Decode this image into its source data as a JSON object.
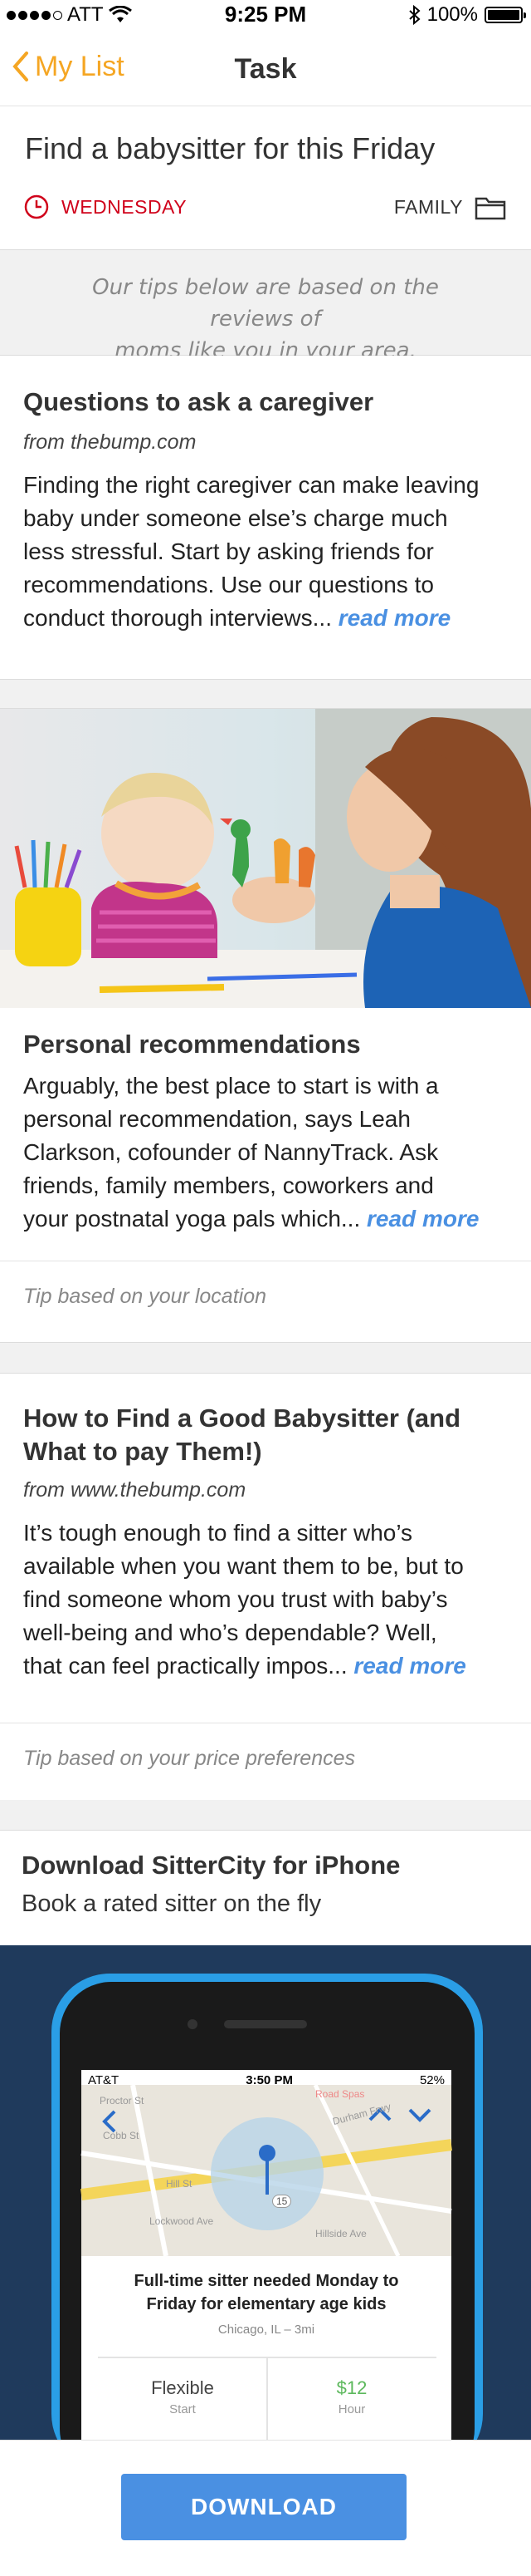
{
  "status_bar": {
    "carrier": "ATT",
    "time": "9:25 PM",
    "battery": "100%"
  },
  "nav": {
    "back_label": "My List",
    "title": "Task"
  },
  "task": {
    "title": "Find a babysitter for this Friday",
    "day": "WEDNESDAY",
    "category": "FAMILY"
  },
  "info_banner": {
    "text_line1": "Our tips below are based on the reviews of",
    "text_line2": "moms like you in your area."
  },
  "cards": [
    {
      "title": "Questions to ask a caregiver",
      "source": "from thebump.com",
      "body_lines": [
        "Finding the right caregiver can make leaving",
        "baby under someone else’s charge much",
        "less stressful. Start by asking friends for",
        "recommendations. Use our questions to"
      ],
      "last_line": "conduct thorough interviews...",
      "read_more": "read more"
    },
    {
      "title": "Personal recommendations",
      "body_lines": [
        "Arguably, the best place to start is with a",
        "personal recommendation, says Leah",
        "Clarkson, cofounder of NannyTrack. Ask",
        "friends, family members, coworkers and"
      ],
      "last_line": "your postnatal yoga pals which...",
      "read_more": "read more",
      "footer": "Tip based on your location"
    },
    {
      "title_line1": "How to Find a Good Babysitter (and",
      "title_line2": "What to pay Them!)",
      "source": "from www.thebump.com",
      "body_lines": [
        "It’s tough enough to find a sitter who’s",
        "available when you want them to be, but to",
        "find someone whom you trust with baby’s",
        "well-being and who’s dependable? Well,"
      ],
      "last_line": "that can feel practically impos...",
      "read_more": "read more",
      "footer": "Tip based on your price preferences"
    }
  ],
  "promo": {
    "title": "Download SitterCity for iPhone",
    "subtitle": "Book a rated sitter on the fly",
    "phone_screen": {
      "carrier": "AT&T",
      "time": "3:50 PM",
      "battery": "52%",
      "map_label_1": "Proctor St",
      "map_label_2": "Cobb St",
      "map_label_3": "Durham Frwy",
      "map_label_4": "Road Spas",
      "map_label_5": "Lockwood Ave",
      "map_label_6": "Hill St",
      "map_label_7": "Hillside Ave",
      "route": "15",
      "job_title_line1": "Full-time sitter needed Monday to",
      "job_title_line2": "Friday for elementary age kids",
      "location": "Chicago, IL – 3mi",
      "start_value": "Flexible",
      "start_label": "Start",
      "rate_value": "$12",
      "rate_label": "Hour"
    },
    "download_label": "DOWNLOAD"
  },
  "colors": {
    "accent": "#f5a623",
    "day_red": "#d0021b",
    "link_blue": "#4a90e2",
    "rate_green": "#5cb85c"
  }
}
